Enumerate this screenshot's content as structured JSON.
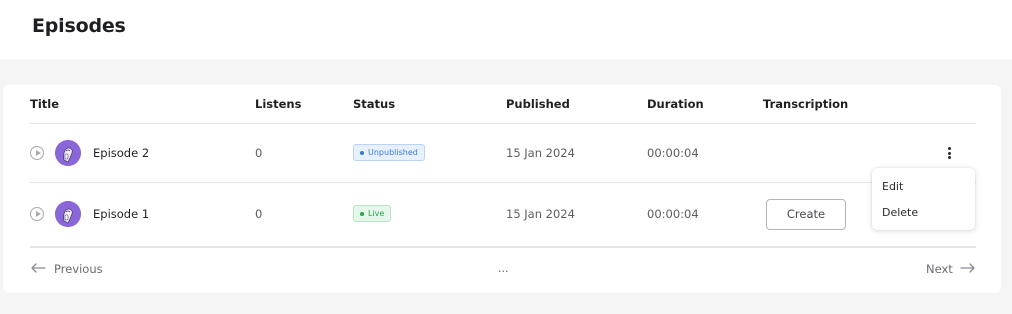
{
  "page": {
    "title": "Episodes"
  },
  "table": {
    "headers": {
      "title": "Title",
      "listens": "Listens",
      "status": "Status",
      "published": "Published",
      "duration": "Duration",
      "transcription": "Transcription"
    },
    "rows": [
      {
        "title": "Episode 2",
        "listens": "0",
        "status": "Unpublished",
        "published": "15 Jan 2024",
        "duration": "00:00:04",
        "transcription": ""
      },
      {
        "title": "Episode 1",
        "listens": "0",
        "status": "Live",
        "published": "15 Jan 2024",
        "duration": "00:00:04",
        "transcription": "Create"
      }
    ]
  },
  "menu": {
    "items": [
      "Edit",
      "Delete"
    ]
  },
  "pagination": {
    "previous": "Previous",
    "next": "Next",
    "ellipsis": "..."
  },
  "colors": {
    "avatar": "#8a66d8",
    "unpublished": "#3a7bd5",
    "live": "#29a24d"
  },
  "icons": {
    "play": "play-circle-icon",
    "more": "more-vertical-icon",
    "arrow_left": "arrow-left-icon",
    "arrow_right": "arrow-right-icon"
  }
}
